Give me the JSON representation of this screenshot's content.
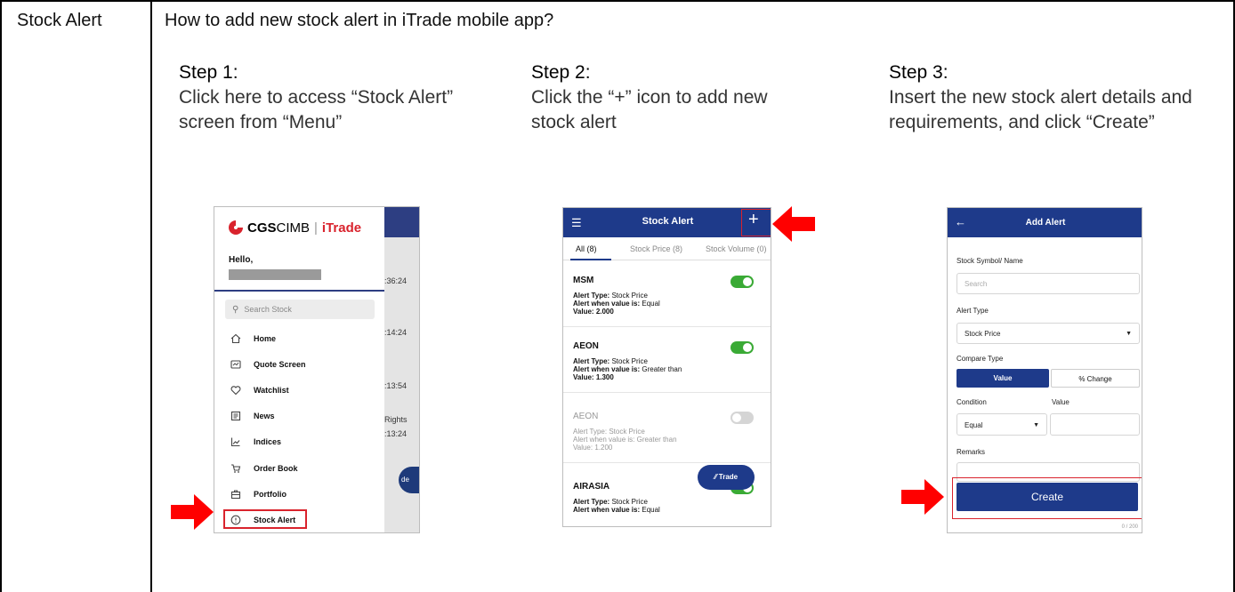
{
  "row_label": "Stock Alert",
  "question": "How to add new stock alert in iTrade mobile app?",
  "steps": [
    {
      "heading": "Step 1:",
      "text": "Click here to access “Stock Alert” screen from “Menu”"
    },
    {
      "heading": "Step 2:",
      "text": "Click the “+” icon to add new stock alert"
    },
    {
      "heading": "Step 3:",
      "text": "Insert the new stock alert details and requirements, and click “Create”"
    }
  ],
  "phone1": {
    "brand_cgs": "CGS",
    "brand_cimb": "CIMB",
    "separator": "|",
    "brand_itrade": "iTrade",
    "hello": "Hello,",
    "search_placeholder": "Search Stock",
    "menu_items": [
      "Home",
      "Quote Screen",
      "Watchlist",
      "News",
      "Indices",
      "Order Book",
      "Portfolio",
      "Stock Alert"
    ],
    "bg_times": [
      ":36:24",
      ":14:24",
      ":13:54",
      "Rights",
      ":13:24"
    ],
    "bg_fab_fragment": "de"
  },
  "phone2": {
    "title": "Stock Alert",
    "plus_icon": "+",
    "tabs": [
      "All (8)",
      "Stock Price (8)",
      "Stock Volume (0)"
    ],
    "alerts": [
      {
        "symbol": "MSM",
        "type_label": "Alert Type:",
        "type": "Stock Price",
        "when_label": "Alert when value is:",
        "when": "Equal",
        "value_label": "Value:",
        "value": "2.000",
        "enabled": true
      },
      {
        "symbol": "AEON",
        "type_label": "Alert Type:",
        "type": "Stock Price",
        "when_label": "Alert when value is:",
        "when": "Greater than",
        "value_label": "Value:",
        "value": "1.300",
        "enabled": true
      },
      {
        "symbol": "AEON",
        "type_label": "Alert Type:",
        "type": "Stock Price",
        "when_label": "Alert when value is:",
        "when": "Greater than",
        "value_label": "Value:",
        "value": "1.200",
        "enabled": false
      },
      {
        "symbol": "AIRASIA",
        "type_label": "Alert Type:",
        "type": "Stock Price",
        "when_label": "Alert when value is:",
        "when": "Equal",
        "enabled": true
      }
    ],
    "trade_button": "Trade"
  },
  "phone3": {
    "title": "Add Alert",
    "symbol_label": "Stock Symbol/ Name",
    "symbol_placeholder": "Search",
    "alert_type_label": "Alert Type",
    "alert_type_value": "Stock Price",
    "compare_type_label": "Compare Type",
    "compare_value": "Value",
    "compare_change": "% Change",
    "condition_label": "Condition",
    "value_label": "Value",
    "condition_value": "Equal",
    "remarks_label": "Remarks",
    "create_button": "Create",
    "counter": "0 / 200"
  },
  "colors": {
    "brand_blue": "#1e3a8a",
    "highlight_red": "#d9232d",
    "toggle_green": "#3aaa35"
  }
}
